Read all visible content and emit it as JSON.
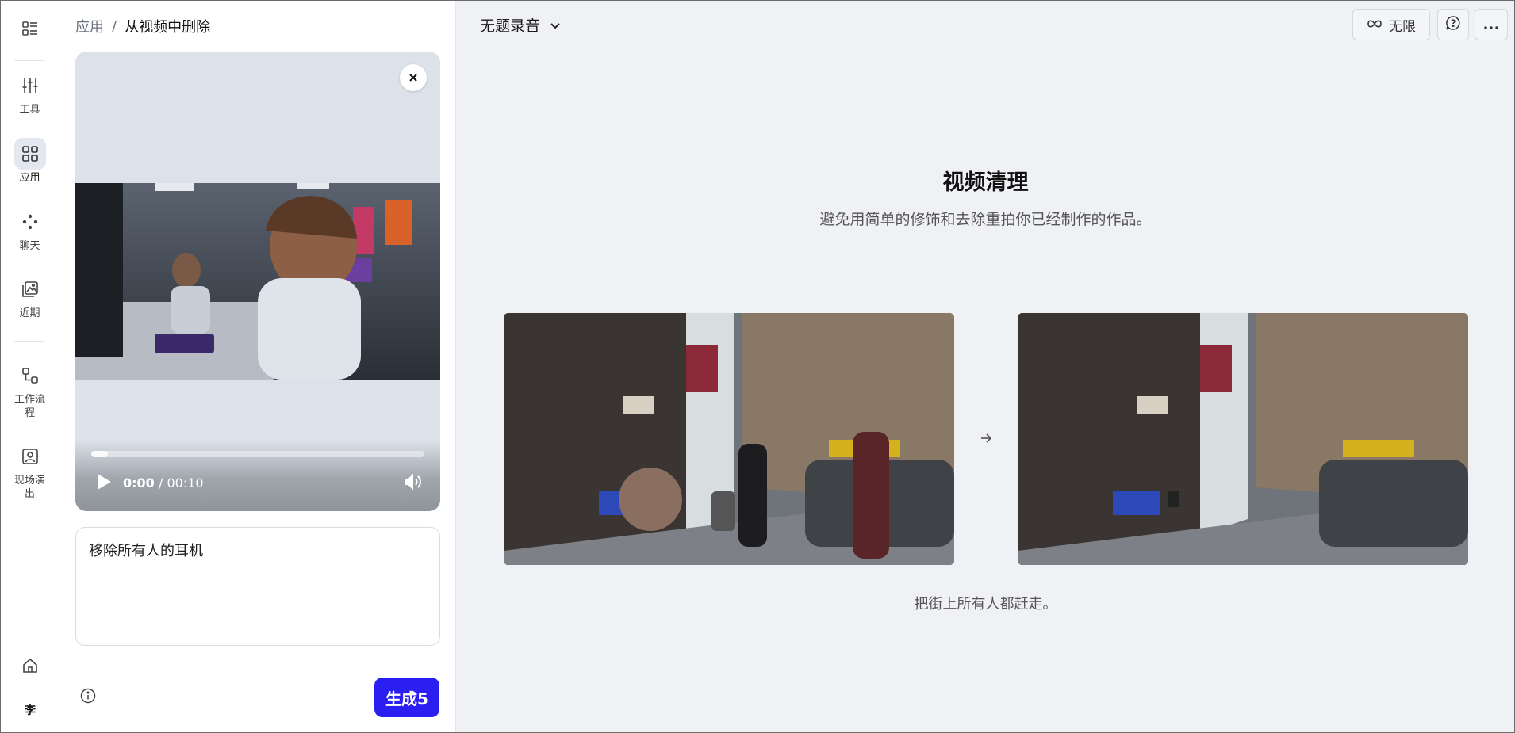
{
  "rail": {
    "items": [
      {
        "label": "",
        "icon": "menu-list-icon"
      },
      {
        "label": "工具",
        "icon": "sliders-icon"
      },
      {
        "label": "应用",
        "icon": "grid-icon",
        "active": true
      },
      {
        "label": "聊天",
        "icon": "chat-dots-icon"
      },
      {
        "label": "近期",
        "icon": "recent-images-icon"
      },
      {
        "label": "工作流程",
        "icon": "workflow-icon"
      },
      {
        "label": "现场演出",
        "icon": "live-portrait-icon"
      },
      {
        "label": "",
        "icon": "home-icon"
      }
    ],
    "avatar": "李"
  },
  "breadcrumb": {
    "parent": "应用",
    "separator": "/",
    "current": "从视频中删除"
  },
  "video": {
    "current_time": "0:00",
    "duration": "/ 00:10",
    "progress_fraction": 0.05
  },
  "prompt": {
    "value": "移除所有人的耳机"
  },
  "generate": {
    "label": "生成5"
  },
  "header": {
    "recording_title": "无题录音",
    "unlimited_label": "无限"
  },
  "feature": {
    "title": "视频清理",
    "description": "避免用简单的修饰和去除重拍你已经制作的作品。",
    "caption": "把街上所有人都赶走。"
  },
  "colors": {
    "accent": "#2a1ff0",
    "active_rail": "#e3e7ef"
  }
}
